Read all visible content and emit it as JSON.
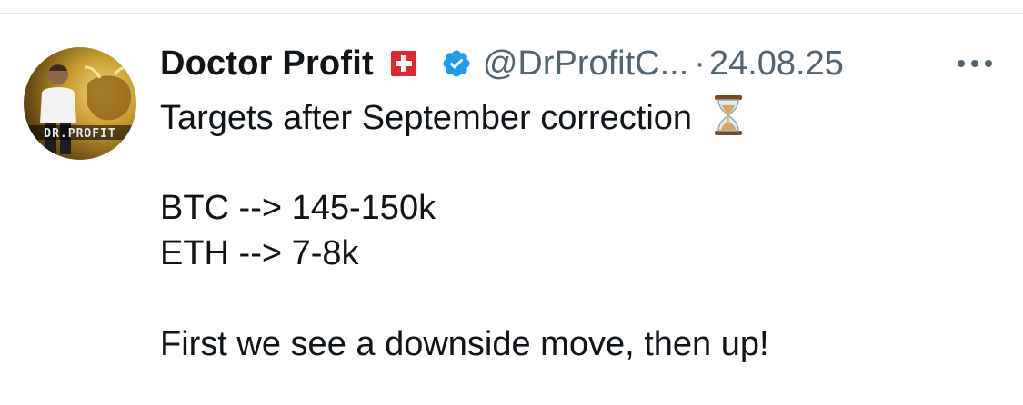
{
  "tweet": {
    "author": {
      "display_name": "Doctor Profit",
      "flag_icon": "swiss-flag-icon",
      "verified_icon": "verified-badge-icon",
      "verified_color": "#1d9bf0",
      "handle": "@DrProfitC...",
      "avatar_text": "DR.PROFIT"
    },
    "separator": "·",
    "date": "24.08.25",
    "more_icon": "more-options-icon",
    "text": {
      "line1": "Targets after September correction",
      "line1_icon": "hourglass-icon",
      "line2": "BTC --> 145-150k",
      "line3": "ETH --> 7-8k",
      "line4": "First we see a downside move, then up!"
    }
  }
}
